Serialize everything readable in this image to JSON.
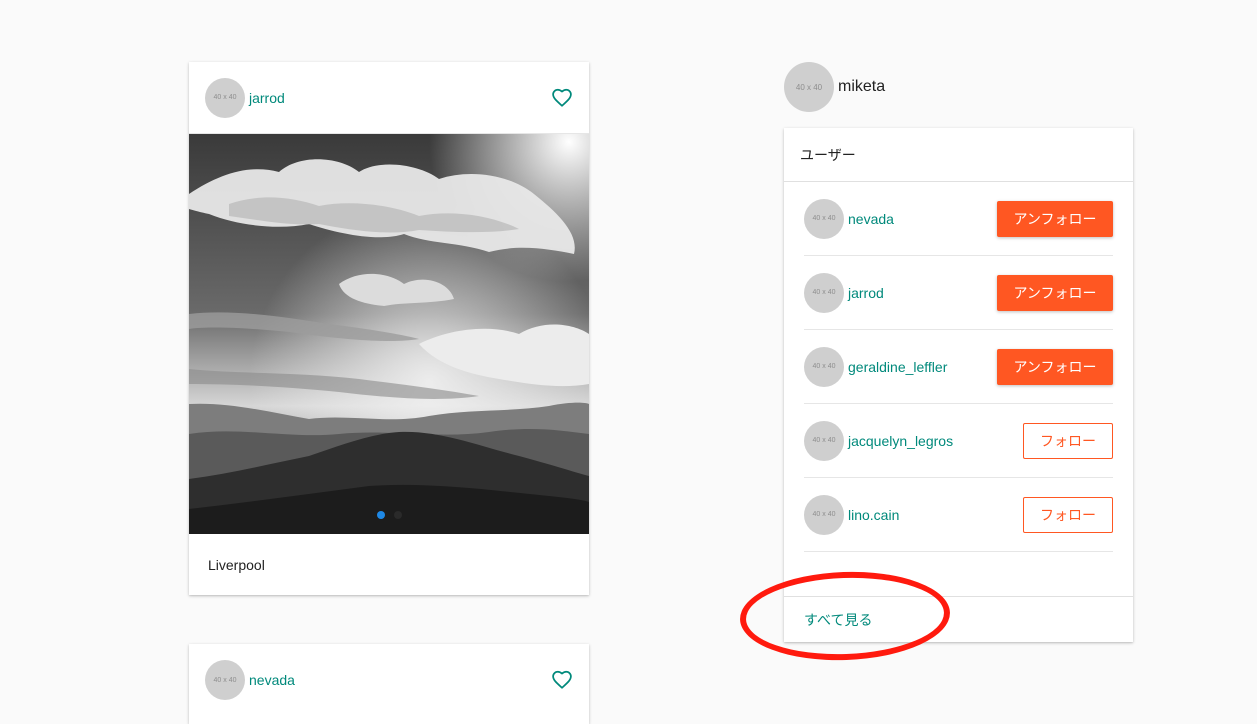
{
  "avatar_placeholder": "40 x 40",
  "posts": [
    {
      "username": "jarrod",
      "caption": "Liverpool",
      "photo_slides": 2,
      "active_slide": 1
    },
    {
      "username": "nevada"
    }
  ],
  "profile": {
    "username": "miketa"
  },
  "users_panel": {
    "title": "ユーザー",
    "users": [
      {
        "username": "nevada",
        "action": "アンフォロー",
        "following": true
      },
      {
        "username": "jarrod",
        "action": "アンフォロー",
        "following": true
      },
      {
        "username": "geraldine_leffler",
        "action": "アンフォロー",
        "following": true
      },
      {
        "username": "jacquelyn_legros",
        "action": "フォロー",
        "following": false
      },
      {
        "username": "lino.cain",
        "action": "フォロー",
        "following": false
      }
    ],
    "see_all": "すべて見る"
  },
  "colors": {
    "link": "#00897b",
    "accent": "#ff5722",
    "annotation": "#ff1a0e",
    "active_dot": "#1e88e5"
  }
}
